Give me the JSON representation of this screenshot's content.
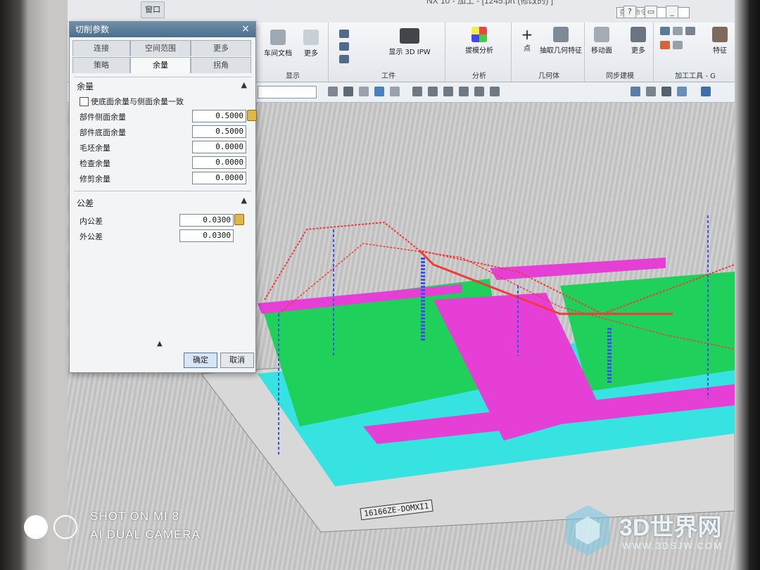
{
  "window": {
    "title": "NX 10 - 加工 - [1245.prt (修改的) ]",
    "quick_access": [
      "窗口"
    ],
    "command_search_placeholder": "查找命令"
  },
  "ribbon": {
    "groups": [
      {
        "name": "显示",
        "buttons": [
          "车间文档",
          "更多"
        ]
      },
      {
        "name": "工件",
        "buttons": [
          "显示 3D IPW"
        ]
      },
      {
        "name": "分析",
        "buttons": [
          "拔模分析"
        ]
      },
      {
        "name": "几何体",
        "buttons": [
          "点",
          "抽取几何特征"
        ]
      },
      {
        "name": "同步建模",
        "buttons": [
          "移动面",
          "更多"
        ]
      },
      {
        "name": "加工工具 - G",
        "buttons": [
          "特征"
        ]
      }
    ]
  },
  "dialog": {
    "title": "切削参数",
    "tabs_row1": [
      "连接",
      "空间范围",
      "更多"
    ],
    "tabs_row2": [
      "策略",
      "余量",
      "拐角"
    ],
    "active_tab": "余量",
    "stock_section": {
      "heading": "余量",
      "checkbox_label": "使底面余量与侧面余量一致",
      "fields": [
        {
          "label": "部件侧面余量",
          "value": "0.5000"
        },
        {
          "label": "部件底面余量",
          "value": "0.5000"
        },
        {
          "label": "毛坯余量",
          "value": "0.0000"
        },
        {
          "label": "检查余量",
          "value": "0.0000"
        },
        {
          "label": "修剪余量",
          "value": "0.0000"
        }
      ]
    },
    "tolerance_section": {
      "heading": "公差",
      "fields": [
        {
          "label": "内公差",
          "value": "0.0300"
        },
        {
          "label": "外公差",
          "value": "0.0300"
        }
      ]
    },
    "ok_label": "确定",
    "cancel_label": "取消"
  },
  "viewport": {
    "part_label": "16166ZE-DOMXI1"
  },
  "watermark": {
    "shot_on": "SHOT ON MI 8",
    "camera": "AI DUAL CAMERA",
    "brand": "3D世界网",
    "url": "WWW.3DSJW.COM"
  },
  "colors": {
    "cyan": "#36e3e0",
    "green": "#1fd15a",
    "magenta": "#e63fd6",
    "toolpath_red": "#ef3b3b",
    "toolpath_blue": "#3a55e3"
  }
}
